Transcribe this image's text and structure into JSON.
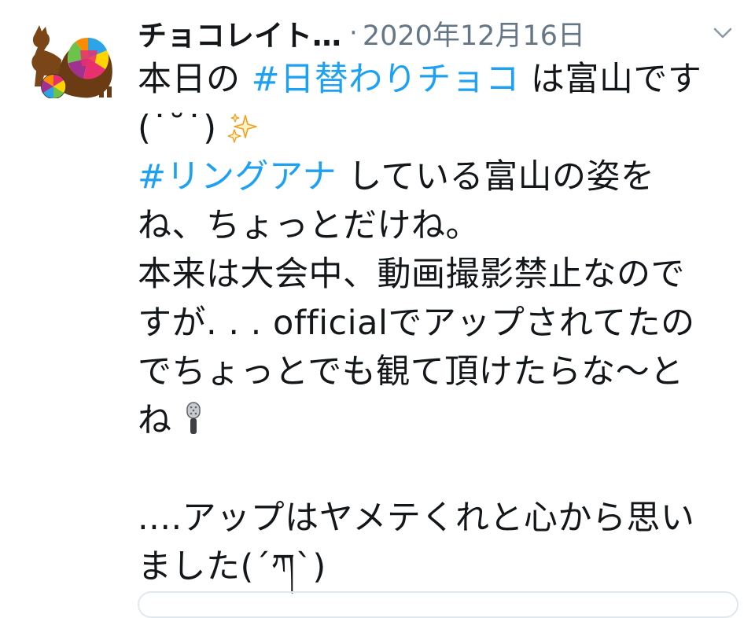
{
  "tweet": {
    "display_name": "チョコレイト…",
    "separator": "·",
    "timestamp": "2020年12月16日",
    "accent_color": "#1da1f2",
    "lines": {
      "l1_pre": "本日の ",
      "l1_tag": "#日替わりチョコ",
      "l1_post": " は富山です",
      "l2_kaomoji": "(˙˘˙)",
      "l3_tag": "#リングアナ",
      "l3_post": " している富山の姿を",
      "l4": "ね、ちょっとだけね。",
      "l5": "本来は大会中、動画撮影禁止なので",
      "l6": "すが. . . officialでアップされてたの",
      "l7": "でちょっとでも観て頂けたらな〜と",
      "l8": "ね",
      "l10": "....アップはヤメテくれと心から思い",
      "l11": "ました(´ཀ`)"
    },
    "icons": {
      "sparkles": "sparkles-icon",
      "microphone": "microphone-icon",
      "more_menu": "chevron-down-icon"
    }
  }
}
